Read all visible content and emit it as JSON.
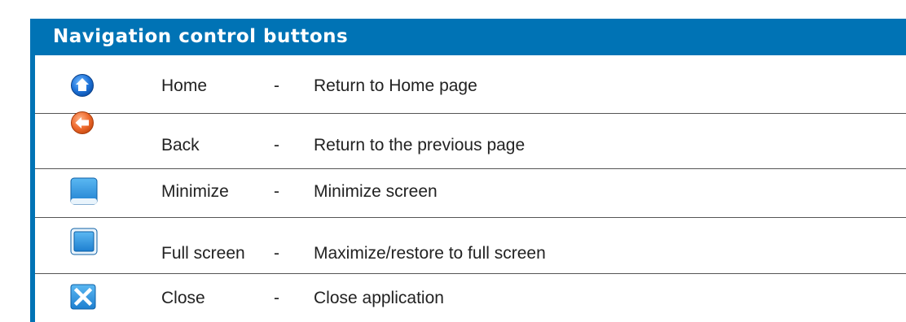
{
  "header": {
    "title": "Navigation control buttons"
  },
  "colors": {
    "header_bg": "#0073b5",
    "header_text": "#ffffff"
  },
  "rows": [
    {
      "icon": "home-icon",
      "name": "Home",
      "dash": "-",
      "desc": "Return to Home page"
    },
    {
      "icon": "back-icon",
      "name": "Back",
      "dash": "-",
      "desc": "Return to the previous page"
    },
    {
      "icon": "minimize-icon",
      "name": "Minimize",
      "dash": "-",
      "desc": "Minimize screen"
    },
    {
      "icon": "full-screen-icon",
      "name": "Full screen",
      "dash": "-",
      "desc": "Maximize/restore to full screen"
    },
    {
      "icon": "close-icon",
      "name": "Close",
      "dash": "-",
      "desc": "Close application"
    }
  ]
}
